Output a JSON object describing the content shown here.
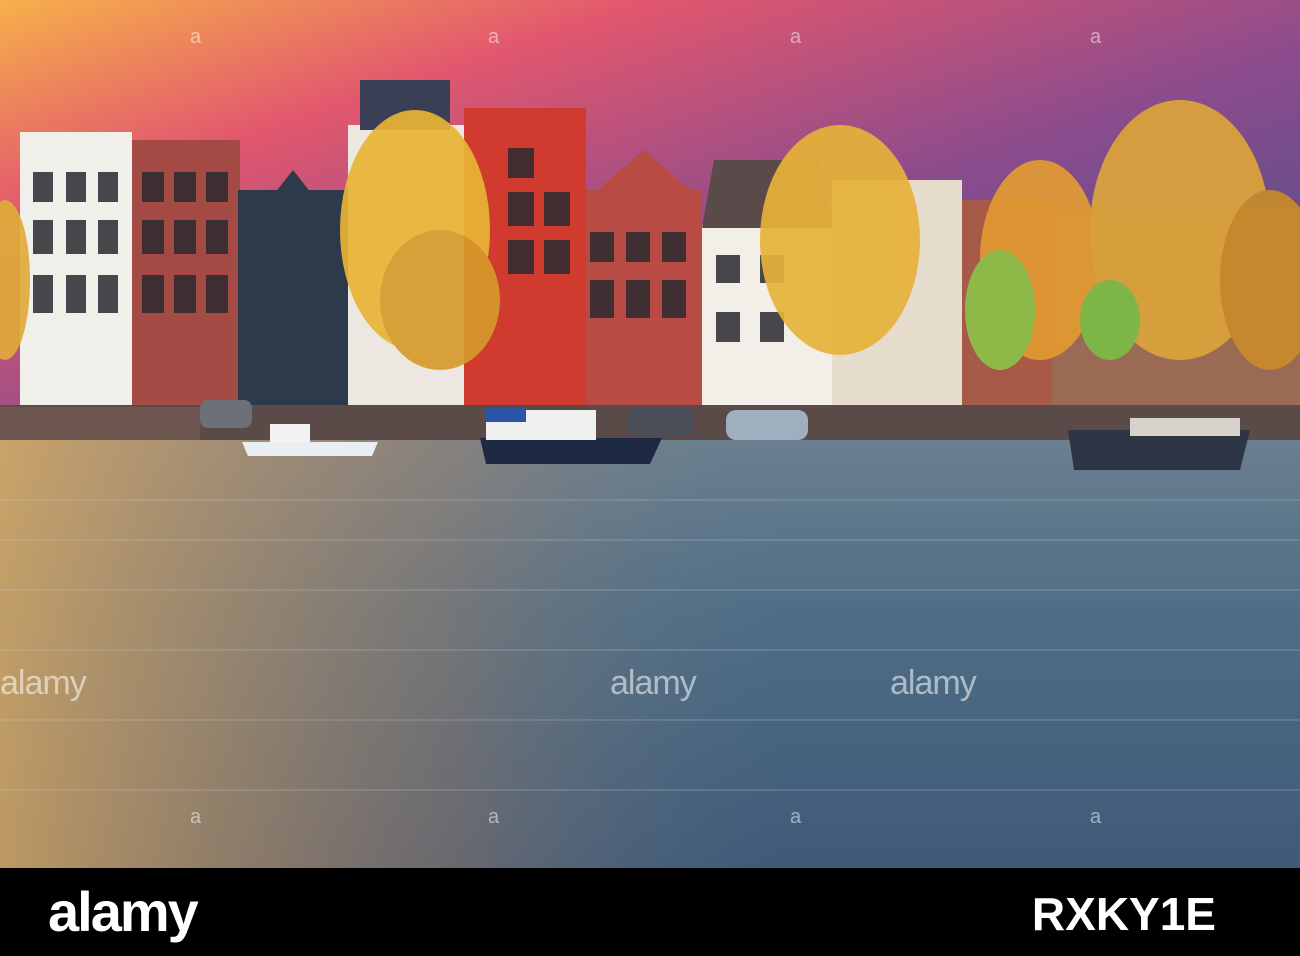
{
  "watermarks": {
    "text": "alamy",
    "corner_mark": "a"
  },
  "footer": {
    "logo": "alamy",
    "image_id": "RXKY1E"
  },
  "colors": {
    "sky_top": "#3d4f8a",
    "sky_mid": "#b6497a",
    "sky_glow": "#f2a03a",
    "water": "#4a6a83",
    "footer_bg": "#000000"
  }
}
